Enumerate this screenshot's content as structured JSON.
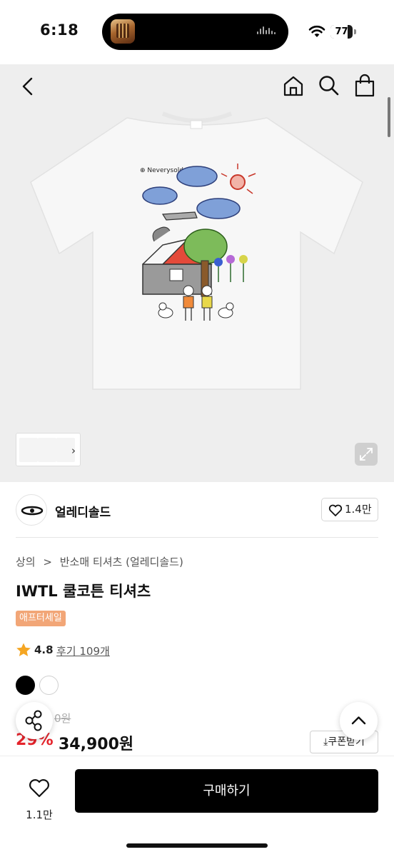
{
  "status_bar": {
    "time": "6:18",
    "battery": "77",
    "battery_level": 0.77
  },
  "header": {
    "back_icon": "chevron-left-icon",
    "home_icon": "home-icon",
    "search_icon": "search-icon",
    "cart_icon": "shopping-bag-icon"
  },
  "brand": {
    "name": "얼레디솔드",
    "likes": "1.4만"
  },
  "breadcrumb": [
    "상의",
    ">",
    "반소매 티셔츠 (얼레디솔드)"
  ],
  "product": {
    "title": "IWTL 쿨코튼 티셔츠",
    "badge": "애프터세일",
    "rating": "4.8",
    "reviews": "후기 109개",
    "original_price": "0원",
    "discount": "29%",
    "price": "34,900원",
    "coupon_button": "쿠폰받기",
    "colors": [
      "#000000",
      "#ffffff"
    ]
  },
  "bottom_bar": {
    "like_count": "1.1만",
    "buy_label": "구매하기"
  },
  "colors": {
    "badge": "#f2a677",
    "discount": "#e5242c",
    "buy_button": "#000000"
  }
}
